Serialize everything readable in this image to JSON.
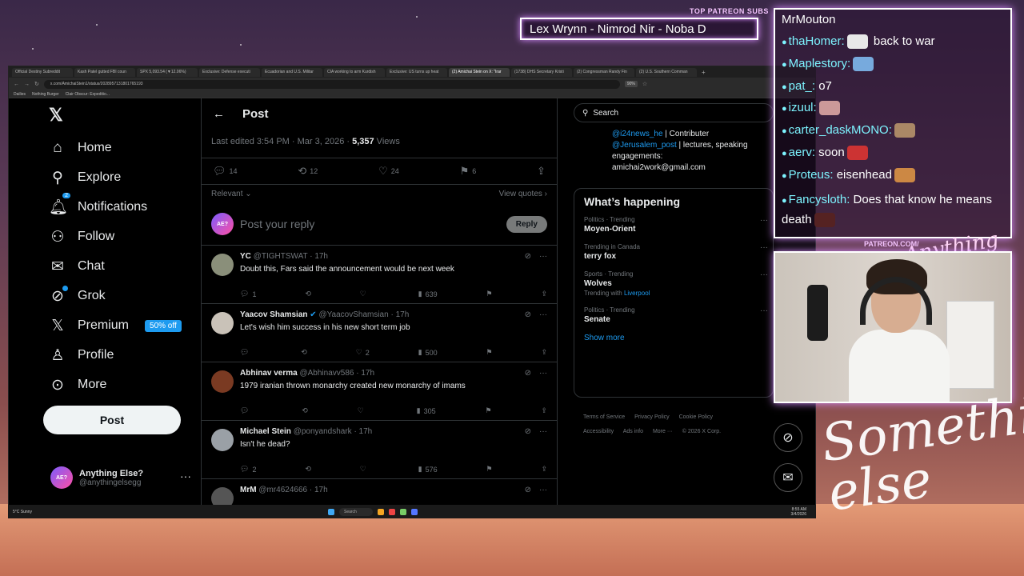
{
  "overlay": {
    "patreon_label": "TOP PATREON SUBS",
    "patreon_names": "Lex Wrynn - Nimrod Nir - Noba D",
    "patreon_tag": "PATREON.COM/",
    "brand_sig": "Anything Else?",
    "signature": "Something else"
  },
  "browser": {
    "tabs": [
      "Official Destiny Subreddit",
      "Kash Patel gutted FBI coun",
      "SPX 5,093.54 (▼12.06%)",
      "Exclusive: Defense executi",
      "Ecuadorian and U.S. Militar",
      "CIA working to arm Kurdish",
      "Exclusive: US turns up heat",
      "(2) Amichai Stein on X: \"Irar",
      "(1738) DHS Secretary Kristi",
      "(2) Congressman Randy Fin",
      "(2) U.S. Southern Comman"
    ],
    "url": "x.com/AmichaiStein1/status/2028957131801765193",
    "zoom": "90%",
    "bookmarks": [
      "Dailies",
      "Nothing Burger",
      "Clair Obscur: Expeditio..."
    ]
  },
  "nav": {
    "items": [
      {
        "label": "Home",
        "icon": "home-icon"
      },
      {
        "label": "Explore",
        "icon": "search-icon"
      },
      {
        "label": "Notifications",
        "icon": "bell-icon",
        "badge": "2"
      },
      {
        "label": "Follow",
        "icon": "person-plus-icon"
      },
      {
        "label": "Chat",
        "icon": "mail-icon"
      },
      {
        "label": "Grok",
        "icon": "grok-icon"
      },
      {
        "label": "Premium",
        "icon": "x-icon",
        "promo": "50% off"
      },
      {
        "label": "Profile",
        "icon": "person-icon"
      },
      {
        "label": "More",
        "icon": "more-circle-icon"
      }
    ],
    "post_button": "Post",
    "account": {
      "name": "Anything Else?",
      "handle": "@anythingelsegg",
      "avatar_text": "AE?"
    }
  },
  "post": {
    "title": "Post",
    "edited": "Last edited 3:54 PM · Mar 3, 2026 · ",
    "views": "5,357",
    "views_label": " Views",
    "counts": {
      "replies": "14",
      "reposts": "12",
      "likes": "24",
      "bookmarks": "6"
    },
    "relevant": "Relevant",
    "view_quotes": "View quotes",
    "reply_placeholder": "Post your reply",
    "reply_button": "Reply"
  },
  "replies": [
    {
      "name": "YC",
      "handle": "@TIGHTSWAT · 17h",
      "verified": false,
      "text": "Doubt this, Fars said the announcement would be next week",
      "replies": "1",
      "likes": "",
      "views": "639",
      "avatar_color": "#8a8f7a"
    },
    {
      "name": "Yaacov Shamsian",
      "handle": "@YaacovShamsian · 17h",
      "verified": true,
      "text": "Let's wish him success in his new short term  job",
      "replies": "",
      "likes": "2",
      "views": "500",
      "avatar_color": "#c9c2b8"
    },
    {
      "name": "Abhinav verma",
      "handle": "@Abhinavv586 · 17h",
      "verified": false,
      "text": "1979 iranian thrown monarchy created new monarchy of imams",
      "replies": "",
      "likes": "",
      "views": "305",
      "avatar_color": "#7a3a22"
    },
    {
      "name": "Michael Stein",
      "handle": "@ponyandshark · 17h",
      "verified": false,
      "text": "Isn't he dead?",
      "replies": "2",
      "likes": "",
      "views": "576",
      "avatar_color": "#9aa0a6"
    },
    {
      "name": "MrM",
      "handle": "@mr4624666 · 17h",
      "verified": false,
      "text": "",
      "replies": "",
      "likes": "",
      "views": "",
      "avatar_color": "#555"
    }
  ],
  "sidebar": {
    "search_placeholder": "Search",
    "bio": {
      "line1_link": "@i24news_he",
      "line1_text": " | Contributer",
      "line2_link": "@Jerusalem_post",
      "line2_text": " | lectures, speaking",
      "line3": "engagements:",
      "line4": "amichai2work@gmail.com"
    },
    "happening_title": "What’s happening",
    "trends": [
      {
        "category": "Politics · Trending",
        "name": "Moyen-Orient",
        "with_label": "",
        "with": ""
      },
      {
        "category": "Trending in Canada",
        "name": "terry fox",
        "with_label": "",
        "with": ""
      },
      {
        "category": "Sports · Trending",
        "name": "Wolves",
        "with_label": "Trending with ",
        "with": "Liverpool"
      },
      {
        "category": "Politics · Trending",
        "name": "Senate",
        "with_label": "",
        "with": ""
      }
    ],
    "show_more": "Show more",
    "footer": [
      "Terms of Service",
      "Privacy Policy",
      "Cookie Policy",
      "Accessibility",
      "Ads info",
      "More ···",
      "© 2026 X Corp."
    ]
  },
  "taskbar": {
    "weather": "5°C Sunny",
    "search": "Search",
    "time": "8:55 AM",
    "date": "3/4/2026"
  },
  "chat": [
    {
      "user": "MrMouton",
      "text": "",
      "plain": true
    },
    {
      "user": "thaHomer:",
      "text": " back to war",
      "emote": "#e8e8e8"
    },
    {
      "user": "Maplestory:",
      "text": "",
      "emote": "#7ad"
    },
    {
      "user": "pat_:",
      "text": " o7"
    },
    {
      "user": "izuul:",
      "text": "",
      "emote": "#c99"
    },
    {
      "user": "carter_daskMONO:",
      "text": "",
      "emote": "#a86"
    },
    {
      "user": "aerv:",
      "text": " soon",
      "emote": "#c33"
    },
    {
      "user": "Proteus:",
      "text": " eisenhead",
      "emote": "#c84"
    },
    {
      "user": "Fancysloth:",
      "text": " Does that know he means death",
      "emote": "#522"
    }
  ]
}
